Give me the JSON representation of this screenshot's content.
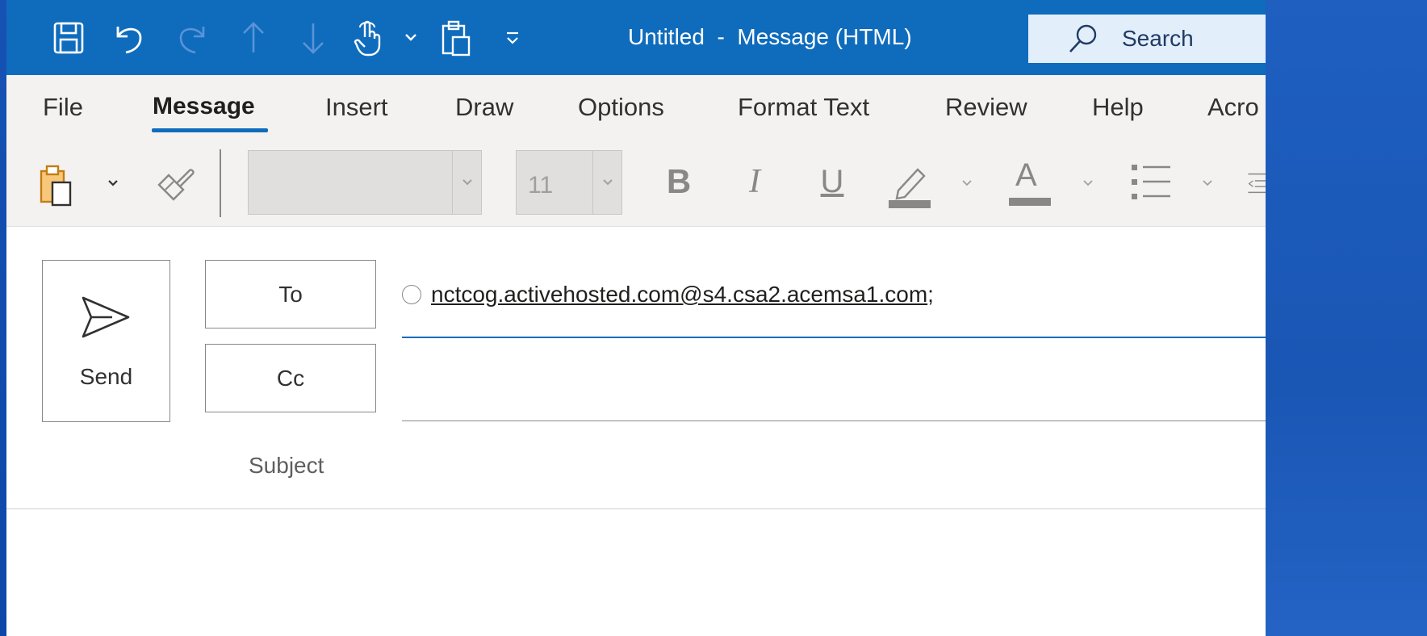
{
  "window": {
    "title": "Untitled  -  Message (HTML)"
  },
  "quick_access": {
    "icons": [
      "save-icon",
      "undo-icon",
      "redo-icon",
      "up-arrow-icon",
      "down-arrow-icon",
      "touch-mode-icon",
      "chevron-down-icon",
      "paste-icon",
      "customize-quick-access-icon"
    ]
  },
  "search": {
    "label": "Search"
  },
  "ribbon": {
    "tabs": [
      {
        "label": "File"
      },
      {
        "label": "Message"
      },
      {
        "label": "Insert"
      },
      {
        "label": "Draw"
      },
      {
        "label": "Options"
      },
      {
        "label": "Format Text"
      },
      {
        "label": "Review"
      },
      {
        "label": "Help"
      },
      {
        "label": "Acro"
      }
    ],
    "active_tab": "Message"
  },
  "toolbar": {
    "font_name": "",
    "font_size": "11",
    "bold": "B",
    "italic": "I",
    "underline": "U",
    "font_color_letter": "A"
  },
  "compose": {
    "send_label": "Send",
    "to_label": "To",
    "cc_label": "Cc",
    "subject_label": "Subject",
    "recipient_address": "nctcog.activehosted.com@s4.csa2.acemsa1.com",
    "recipient_separator": ";"
  },
  "colors": {
    "title_bar": "#0f6cbd",
    "ribbon_bg": "#f3f2f1",
    "accent": "#0f6cbd"
  }
}
